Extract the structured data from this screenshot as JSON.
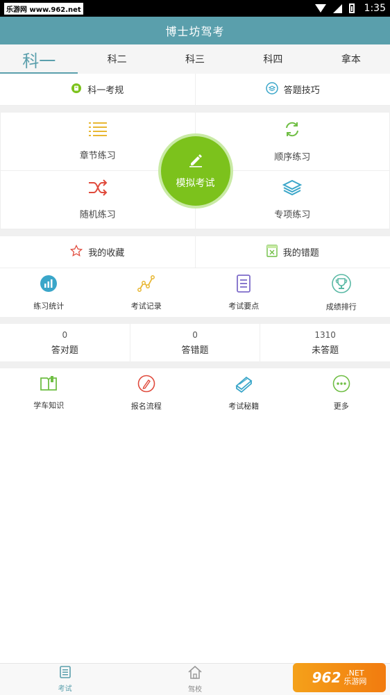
{
  "statusbar": {
    "watermark": "乐游网 www.962.net",
    "time": "1:35"
  },
  "app": {
    "title": "博士坊驾考"
  },
  "tabs": [
    {
      "label": "科一",
      "active": true
    },
    {
      "label": "科二",
      "active": false
    },
    {
      "label": "科三",
      "active": false
    },
    {
      "label": "科四",
      "active": false
    },
    {
      "label": "拿本",
      "active": false
    }
  ],
  "top_links": {
    "rules": "科一考规",
    "tips": "答题技巧"
  },
  "practice": {
    "chapter": "章节练习",
    "sequence": "顺序练习",
    "random": "随机练习",
    "special": "专项练习",
    "exam": "模拟考试"
  },
  "favorites": {
    "collect": "我的收藏",
    "wrong": "我的错题"
  },
  "tools": [
    {
      "label": "练习统计",
      "icon": "bar-chart-icon"
    },
    {
      "label": "考试记录",
      "icon": "line-record-icon"
    },
    {
      "label": "考试要点",
      "icon": "document-icon"
    },
    {
      "label": "成绩排行",
      "icon": "trophy-icon"
    }
  ],
  "stats": [
    {
      "value": "0",
      "label": "答对题"
    },
    {
      "value": "0",
      "label": "答错题"
    },
    {
      "value": "1310",
      "label": "未答题"
    }
  ],
  "more": [
    {
      "label": "学车知识",
      "icon": "book-icon"
    },
    {
      "label": "报名流程",
      "icon": "pen-circle-icon"
    },
    {
      "label": "考试秘籍",
      "icon": "books-stack-icon"
    },
    {
      "label": "更多",
      "icon": "more-icon"
    }
  ],
  "tabbar": [
    {
      "label": "考试",
      "active": true
    },
    {
      "label": "驾校",
      "active": false
    }
  ],
  "brand_watermark": {
    "big": "962",
    "net": ".NET",
    "site": "乐游网"
  },
  "colors": {
    "primary": "#5a9fac",
    "exam_green": "#7cc21c",
    "yellow": "#e8b733",
    "red": "#e04a3c",
    "teal": "#3aa6c9",
    "green_icon": "#6fbe44",
    "purple": "#7d6bc9",
    "orange_watermark": "#f4a11a"
  }
}
